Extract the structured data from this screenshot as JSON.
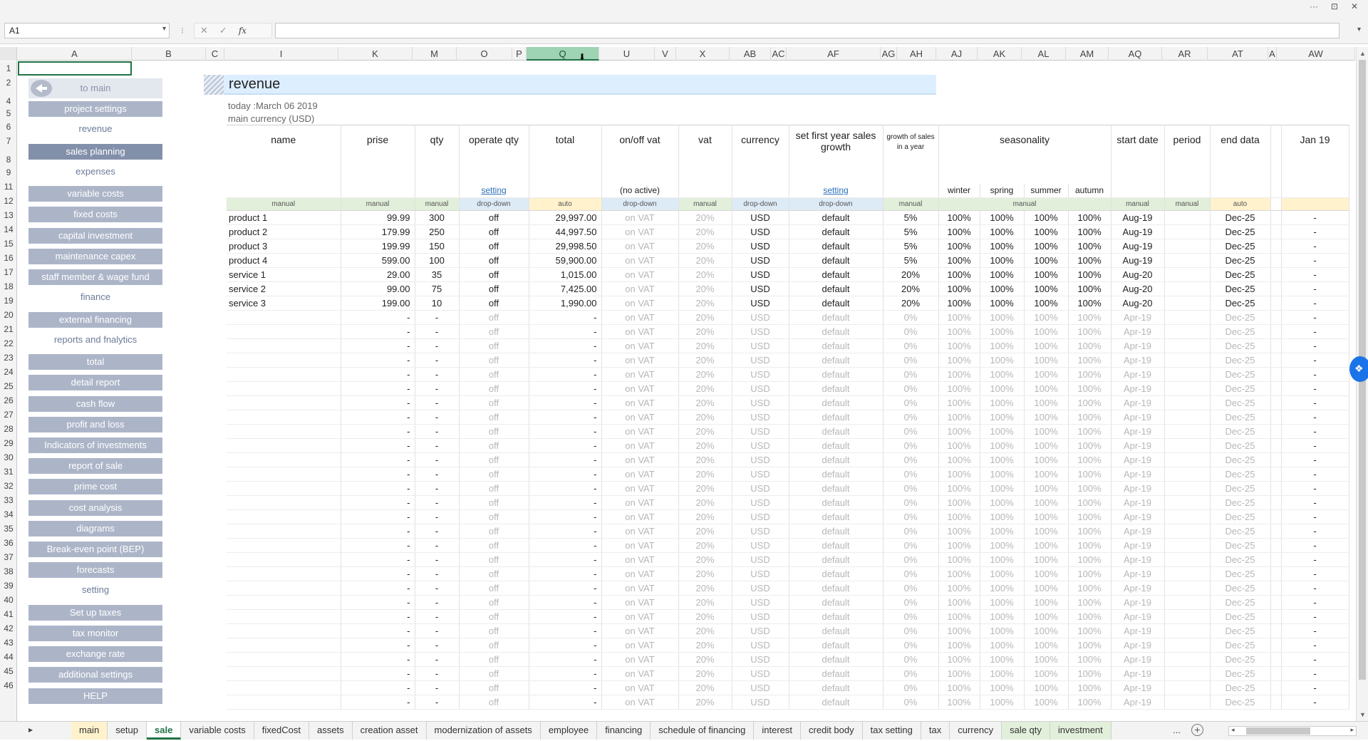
{
  "window": {
    "controls": [
      "···",
      "⊡",
      "✕"
    ]
  },
  "formula_bar": {
    "name_box": "A1",
    "formula": "",
    "cancel": "✕",
    "confirm": "✓",
    "fx": "fx"
  },
  "columns": [
    "A",
    "B",
    "C",
    "I",
    "K",
    "M",
    "O",
    "P",
    "Q",
    "U",
    "V",
    "X",
    "AB",
    "AC",
    "AF",
    "AG",
    "AH",
    "AJ",
    "AK",
    "AL",
    "AM",
    "AQ",
    "AR",
    "AT",
    "A",
    "AW"
  ],
  "rows": [
    "1",
    "2",
    "4",
    "5",
    "6",
    "7",
    "8",
    "9",
    "11",
    "12",
    "13",
    "14",
    "15",
    "16",
    "17",
    "18",
    "19",
    "20",
    "21",
    "22",
    "23",
    "24",
    "25",
    "26",
    "27",
    "28",
    "29",
    "30",
    "31",
    "32",
    "33",
    "34",
    "35",
    "36",
    "37",
    "38",
    "39",
    "40",
    "41",
    "42",
    "43",
    "44",
    "45",
    "46"
  ],
  "sidebar": {
    "to_main": "to main",
    "items": [
      {
        "type": "button",
        "label": "project settings"
      },
      {
        "type": "label",
        "label": "revenue"
      },
      {
        "type": "button",
        "label": "sales planning",
        "active": true
      },
      {
        "type": "label",
        "label": "expenses"
      },
      {
        "type": "button",
        "label": "variable costs"
      },
      {
        "type": "button",
        "label": "fixed costs"
      },
      {
        "type": "button",
        "label": "capital investment"
      },
      {
        "type": "button",
        "label": "maintenance capex"
      },
      {
        "type": "button",
        "label": "staff member & wage fund"
      },
      {
        "type": "label",
        "label": "finance"
      },
      {
        "type": "button",
        "label": "external financing"
      },
      {
        "type": "label",
        "label": "reports and fnalytics"
      },
      {
        "type": "button",
        "label": "total"
      },
      {
        "type": "button",
        "label": "detail report"
      },
      {
        "type": "button",
        "label": "cash flow"
      },
      {
        "type": "button",
        "label": "profit and loss"
      },
      {
        "type": "button",
        "label": "Indicators of investments"
      },
      {
        "type": "button",
        "label": "report of sale"
      },
      {
        "type": "button",
        "label": "prime cost"
      },
      {
        "type": "button",
        "label": "cost analysis"
      },
      {
        "type": "button",
        "label": "diagrams"
      },
      {
        "type": "button",
        "label": "Break-even point (BEP)"
      },
      {
        "type": "button",
        "label": "forecasts"
      },
      {
        "type": "label",
        "label": "setting"
      },
      {
        "type": "button",
        "label": "Set up taxes"
      },
      {
        "type": "button",
        "label": "tax monitor"
      },
      {
        "type": "button",
        "label": "exchange rate"
      },
      {
        "type": "button",
        "label": "additional settings"
      },
      {
        "type": "button",
        "label": "HELP"
      }
    ]
  },
  "page": {
    "title": "revenue",
    "today": "today :March 06 2019",
    "currency": "main currency (USD)"
  },
  "table": {
    "headers": {
      "name": "name",
      "prise": "prise",
      "qty": "qty",
      "operate_qty": "operate qty",
      "total": "total",
      "vat_onoff": "on/off vat",
      "vat": "vat",
      "currency": "currency",
      "growth_setting": "set first year sales growth",
      "growth_year": "growth of sales in a year",
      "seasonality": "seasonality",
      "start_date": "start date",
      "period": "period",
      "end_data": "end data",
      "jan": "Jan 19"
    },
    "sub": {
      "setting_link": "setting",
      "no_active": "(no active)",
      "setting_link2": "setting",
      "winter": "winter",
      "spring": "spring",
      "summer": "summer",
      "autumn": "autumn"
    },
    "types": [
      "manual",
      "manual",
      "manual",
      "drop-down",
      "auto",
      "drop-down",
      "manual",
      "drop-down",
      "drop-down",
      "manual",
      "manual",
      "manual",
      "manual",
      "auto",
      ""
    ],
    "rows": [
      {
        "name": "product 1",
        "prise": "99.99",
        "qty": "300",
        "op": "off",
        "total": "29,997.00",
        "vatsw": "on VAT",
        "vat": "20%",
        "cur": "USD",
        "grs": "default",
        "gry": "5%",
        "w": "100%",
        "sp": "100%",
        "su": "100%",
        "au": "100%",
        "start": "Aug-19",
        "period": "",
        "end": "Dec-25",
        "jan": "-"
      },
      {
        "name": "product 2",
        "prise": "179.99",
        "qty": "250",
        "op": "off",
        "total": "44,997.50",
        "vatsw": "on VAT",
        "vat": "20%",
        "cur": "USD",
        "grs": "default",
        "gry": "5%",
        "w": "100%",
        "sp": "100%",
        "su": "100%",
        "au": "100%",
        "start": "Aug-19",
        "period": "",
        "end": "Dec-25",
        "jan": "-"
      },
      {
        "name": "product 3",
        "prise": "199.99",
        "qty": "150",
        "op": "off",
        "total": "29,998.50",
        "vatsw": "on VAT",
        "vat": "20%",
        "cur": "USD",
        "grs": "default",
        "gry": "5%",
        "w": "100%",
        "sp": "100%",
        "su": "100%",
        "au": "100%",
        "start": "Aug-19",
        "period": "",
        "end": "Dec-25",
        "jan": "-"
      },
      {
        "name": "product 4",
        "prise": "599.00",
        "qty": "100",
        "op": "off",
        "total": "59,900.00",
        "vatsw": "on VAT",
        "vat": "20%",
        "cur": "USD",
        "grs": "default",
        "gry": "5%",
        "w": "100%",
        "sp": "100%",
        "su": "100%",
        "au": "100%",
        "start": "Aug-19",
        "period": "",
        "end": "Dec-25",
        "jan": "-"
      },
      {
        "name": "service 1",
        "prise": "29.00",
        "qty": "35",
        "op": "off",
        "total": "1,015.00",
        "vatsw": "on VAT",
        "vat": "20%",
        "cur": "USD",
        "grs": "default",
        "gry": "20%",
        "w": "100%",
        "sp": "100%",
        "su": "100%",
        "au": "100%",
        "start": "Aug-20",
        "period": "",
        "end": "Dec-25",
        "jan": "-"
      },
      {
        "name": "service 2",
        "prise": "99.00",
        "qty": "75",
        "op": "off",
        "total": "7,425.00",
        "vatsw": "on VAT",
        "vat": "20%",
        "cur": "USD",
        "grs": "default",
        "gry": "20%",
        "w": "100%",
        "sp": "100%",
        "su": "100%",
        "au": "100%",
        "start": "Aug-20",
        "period": "",
        "end": "Dec-25",
        "jan": "-"
      },
      {
        "name": "service 3",
        "prise": "199.00",
        "qty": "10",
        "op": "off",
        "total": "1,990.00",
        "vatsw": "on VAT",
        "vat": "20%",
        "cur": "USD",
        "grs": "default",
        "gry": "20%",
        "w": "100%",
        "sp": "100%",
        "su": "100%",
        "au": "100%",
        "start": "Aug-20",
        "period": "",
        "end": "Dec-25",
        "jan": "-"
      }
    ],
    "empty_row": {
      "name": "",
      "prise": "-",
      "qty": "-",
      "op": "off",
      "total": "-",
      "vatsw": "on VAT",
      "vat": "20%",
      "cur": "USD",
      "grs": "default",
      "gry": "0%",
      "w": "100%",
      "sp": "100%",
      "su": "100%",
      "au": "100%",
      "start": "Apr-19",
      "period": "",
      "end": "Dec-25",
      "jan": "-"
    },
    "empty_row_count": 28
  },
  "tabs": [
    "main",
    "setup",
    "sale",
    "variable costs",
    "fixedCost",
    "assets",
    "creation asset",
    "modernization of assets",
    "employee",
    "financing",
    "schedule of financing",
    "interest",
    "credit body",
    "tax setting",
    "tax",
    "currency",
    "sale qty",
    "investment"
  ],
  "active_tab": "sale",
  "tab_more": "...",
  "tab_add": "+",
  "colors": {
    "nav_button": "#acb5c8",
    "nav_active": "#8390aa",
    "manual": "#e2efda",
    "dropdown": "#ddebf7",
    "auto": "#fff2cc",
    "accent": "#217346"
  }
}
